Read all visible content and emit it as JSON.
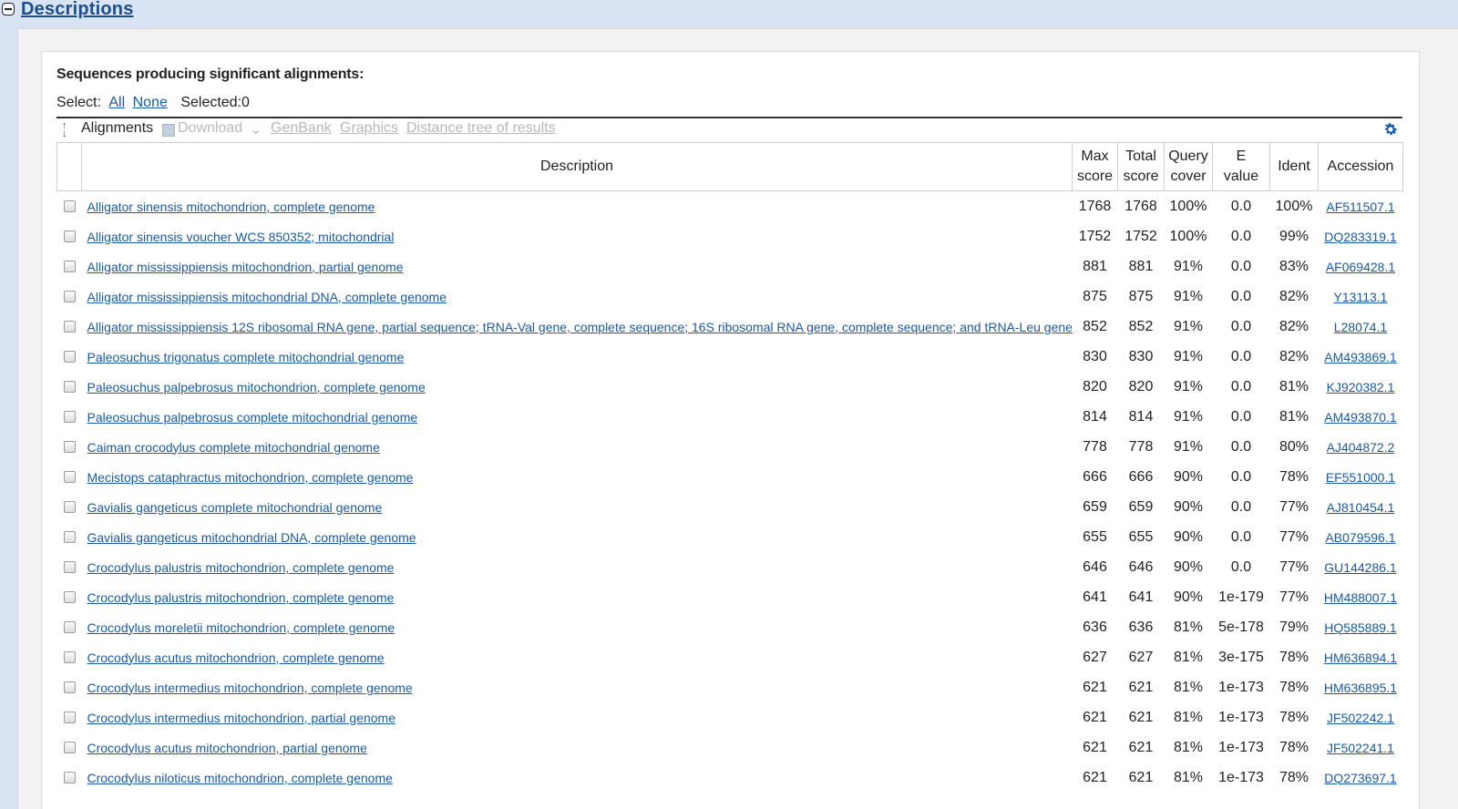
{
  "section": {
    "title": "Descriptions"
  },
  "heading": "Sequences producing significant alignments:",
  "select": {
    "label": "Select:",
    "all": "All",
    "none": "None",
    "selected": "Selected:0"
  },
  "toolbar": {
    "alignments": "Alignments",
    "download": "Download",
    "genbank": "GenBank",
    "graphics": "Graphics",
    "distance_tree": "Distance tree of results"
  },
  "columns": {
    "description": "Description",
    "max_score_1": "Max",
    "max_score_2": "score",
    "total_score_1": "Total",
    "total_score_2": "score",
    "query_cover_1": "Query",
    "query_cover_2": "cover",
    "e_value_1": "E",
    "e_value_2": "value",
    "ident": "Ident",
    "accession": "Accession"
  },
  "rows": [
    {
      "description": "Alligator sinensis mitochondrion, complete genome",
      "max": "1768",
      "total": "1768",
      "cover": "100%",
      "evalue": "0.0",
      "ident": "100%",
      "accession": "AF511507.1"
    },
    {
      "description": "Alligator sinensis voucher WCS 850352; mitochondrial",
      "max": "1752",
      "total": "1752",
      "cover": "100%",
      "evalue": "0.0",
      "ident": "99%",
      "accession": "DQ283319.1"
    },
    {
      "description": "Alligator mississippiensis mitochondrion, partial genome",
      "max": "881",
      "total": "881",
      "cover": "91%",
      "evalue": "0.0",
      "ident": "83%",
      "accession": "AF069428.1"
    },
    {
      "description": "Alligator mississippiensis mitochondrial DNA, complete genome",
      "max": "875",
      "total": "875",
      "cover": "91%",
      "evalue": "0.0",
      "ident": "82%",
      "accession": "Y13113.1"
    },
    {
      "description": "Alligator mississippiensis 12S ribosomal RNA gene, partial sequence; tRNA-Val gene, complete sequence; 16S ribosomal RNA gene, complete sequence; and tRNA-Leu gene",
      "max": "852",
      "total": "852",
      "cover": "91%",
      "evalue": "0.0",
      "ident": "82%",
      "accession": "L28074.1"
    },
    {
      "description": "Paleosuchus trigonatus complete mitochondrial genome",
      "max": "830",
      "total": "830",
      "cover": "91%",
      "evalue": "0.0",
      "ident": "82%",
      "accession": "AM493869.1"
    },
    {
      "description": "Paleosuchus palpebrosus mitochondrion, complete genome",
      "max": "820",
      "total": "820",
      "cover": "91%",
      "evalue": "0.0",
      "ident": "81%",
      "accession": "KJ920382.1"
    },
    {
      "description": "Paleosuchus palpebrosus complete mitochondrial genome",
      "max": "814",
      "total": "814",
      "cover": "91%",
      "evalue": "0.0",
      "ident": "81%",
      "accession": "AM493870.1"
    },
    {
      "description": "Caiman crocodylus complete mitochondrial genome",
      "max": "778",
      "total": "778",
      "cover": "91%",
      "evalue": "0.0",
      "ident": "80%",
      "accession": "AJ404872.2"
    },
    {
      "description": "Mecistops cataphractus mitochondrion, complete genome",
      "max": "666",
      "total": "666",
      "cover": "90%",
      "evalue": "0.0",
      "ident": "78%",
      "accession": "EF551000.1"
    },
    {
      "description": "Gavialis gangeticus complete mitochondrial genome",
      "max": "659",
      "total": "659",
      "cover": "90%",
      "evalue": "0.0",
      "ident": "77%",
      "accession": "AJ810454.1"
    },
    {
      "description": "Gavialis gangeticus mitochondrial DNA, complete genome",
      "max": "655",
      "total": "655",
      "cover": "90%",
      "evalue": "0.0",
      "ident": "77%",
      "accession": "AB079596.1"
    },
    {
      "description": "Crocodylus palustris mitochondrion, complete genome",
      "max": "646",
      "total": "646",
      "cover": "90%",
      "evalue": "0.0",
      "ident": "77%",
      "accession": "GU144286.1"
    },
    {
      "description": "Crocodylus palustris mitochondrion, complete genome",
      "max": "641",
      "total": "641",
      "cover": "90%",
      "evalue": "1e-179",
      "ident": "77%",
      "accession": "HM488007.1"
    },
    {
      "description": "Crocodylus moreletii mitochondrion, complete genome",
      "max": "636",
      "total": "636",
      "cover": "81%",
      "evalue": "5e-178",
      "ident": "79%",
      "accession": "HQ585889.1"
    },
    {
      "description": "Crocodylus acutus mitochondrion, complete genome",
      "max": "627",
      "total": "627",
      "cover": "81%",
      "evalue": "3e-175",
      "ident": "78%",
      "accession": "HM636894.1"
    },
    {
      "description": "Crocodylus intermedius mitochondrion, complete genome",
      "max": "621",
      "total": "621",
      "cover": "81%",
      "evalue": "1e-173",
      "ident": "78%",
      "accession": "HM636895.1"
    },
    {
      "description": "Crocodylus intermedius mitochondrion, partial genome",
      "max": "621",
      "total": "621",
      "cover": "81%",
      "evalue": "1e-173",
      "ident": "78%",
      "accession": "JF502242.1"
    },
    {
      "description": "Crocodylus acutus mitochondrion, partial genome",
      "max": "621",
      "total": "621",
      "cover": "81%",
      "evalue": "1e-173",
      "ident": "78%",
      "accession": "JF502241.1"
    },
    {
      "description": "Crocodylus niloticus mitochondrion, complete genome",
      "max": "621",
      "total": "621",
      "cover": "81%",
      "evalue": "1e-173",
      "ident": "78%",
      "accession": "DQ273697.1"
    }
  ]
}
